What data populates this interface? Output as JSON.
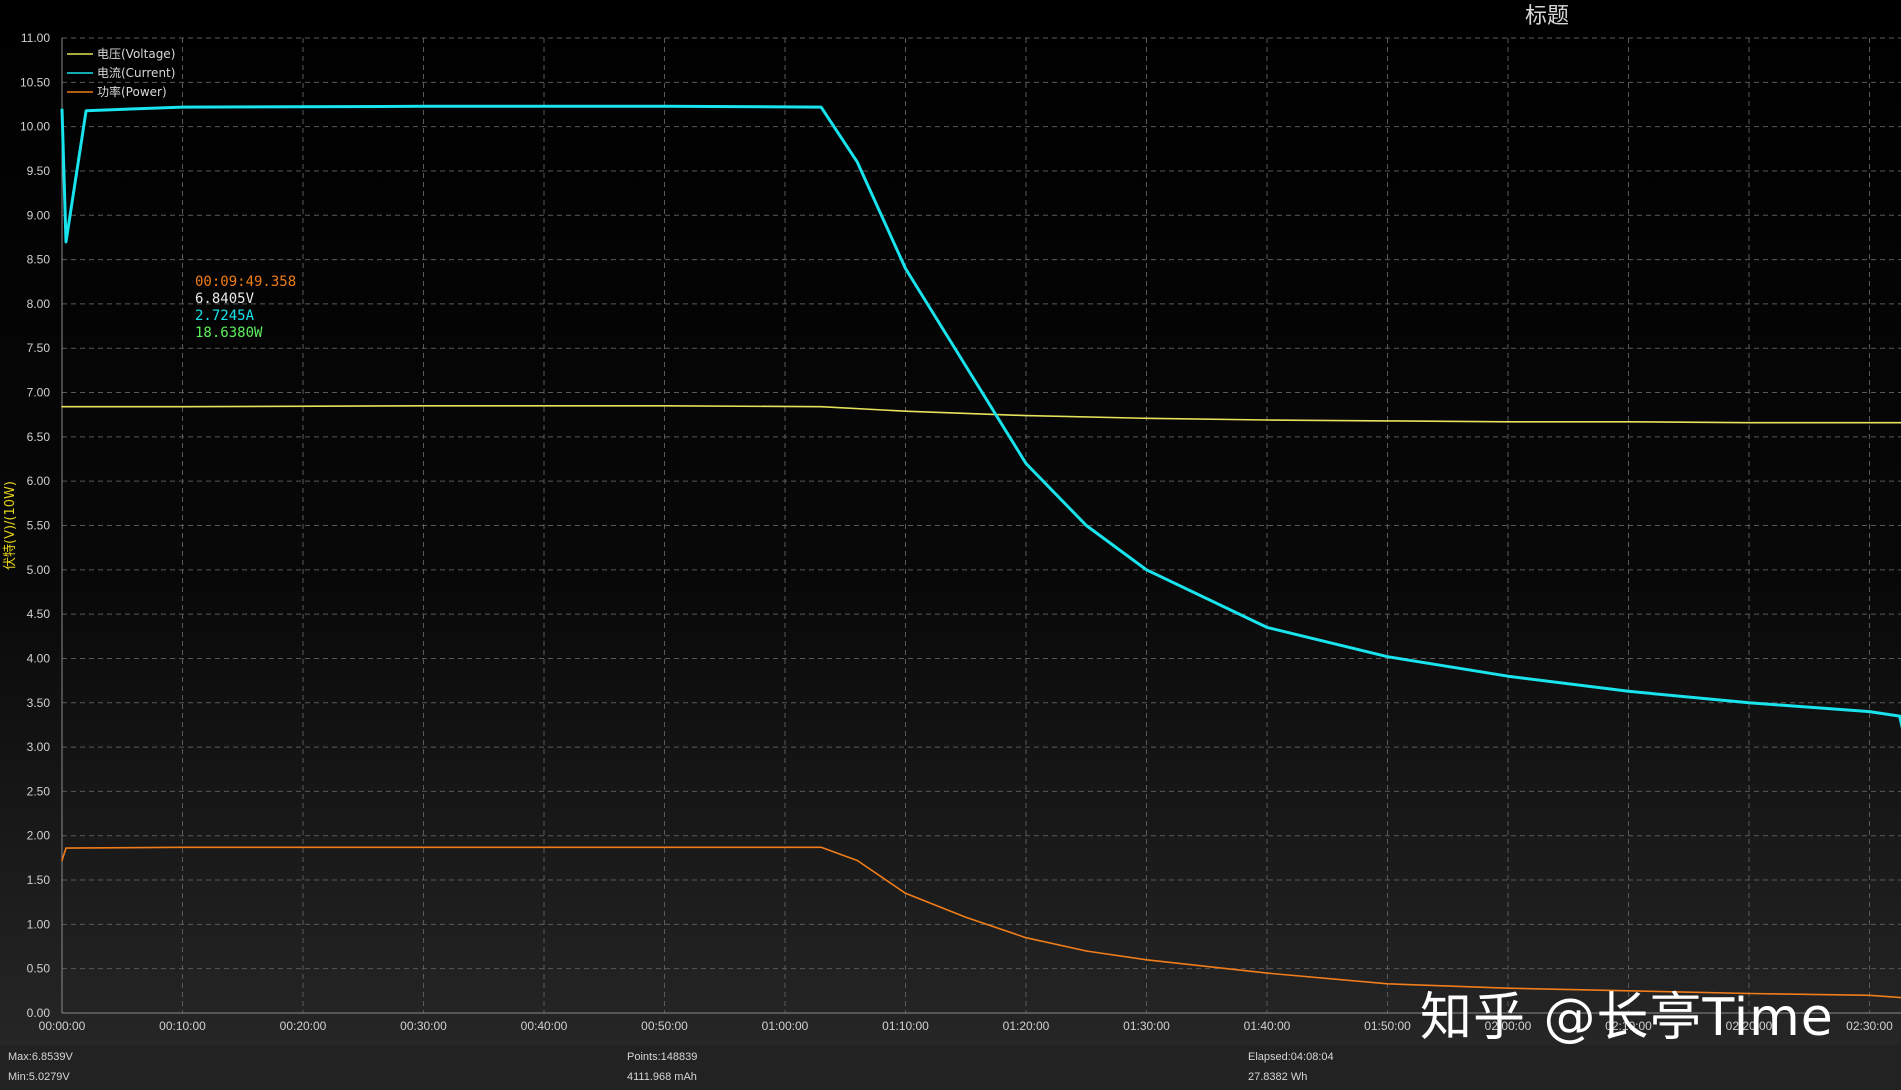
{
  "chart_data": {
    "type": "line",
    "title": "标题",
    "ylabel": "伏特(V)/(10W)",
    "xlabel": "",
    "ylim": [
      0,
      11
    ],
    "xlim_minutes": [
      0,
      153
    ],
    "grid": true,
    "legend_position": "top-left",
    "y_ticks": [
      "0.00",
      "0.50",
      "1.00",
      "1.50",
      "2.00",
      "2.50",
      "3.00",
      "3.50",
      "4.00",
      "4.50",
      "5.00",
      "5.50",
      "6.00",
      "6.50",
      "7.00",
      "7.50",
      "8.00",
      "8.50",
      "9.00",
      "9.50",
      "10.00",
      "10.50",
      "11.00"
    ],
    "x_ticks": [
      "00:00:00",
      "00:10:00",
      "00:20:00",
      "00:30:00",
      "00:40:00",
      "00:50:00",
      "01:00:00",
      "01:10:00",
      "01:20:00",
      "01:30:00",
      "01:40:00",
      "01:50:00",
      "02:00:00",
      "02:10:00",
      "02:20:00",
      "02:30:00"
    ],
    "series": [
      {
        "name": "电压(Voltage)",
        "color": "#e6e25a",
        "x": [
          "00:00:00",
          "00:10:00",
          "00:30:00",
          "00:50:00",
          "01:03:00",
          "01:10:00",
          "01:20:00",
          "01:30:00",
          "01:40:00",
          "01:50:00",
          "02:00:00",
          "02:10:00",
          "02:20:00",
          "02:30:00",
          "02:33:00"
        ],
        "values": [
          6.84,
          6.84,
          6.85,
          6.85,
          6.84,
          6.79,
          6.74,
          6.71,
          6.69,
          6.68,
          6.67,
          6.67,
          6.66,
          6.66,
          6.66
        ]
      },
      {
        "name": "电流(Current)",
        "color": "#19e3ec",
        "x": [
          "00:00:00",
          "00:00:20",
          "00:02:00",
          "00:10:00",
          "00:30:00",
          "00:50:00",
          "01:03:00",
          "01:06:00",
          "01:10:00",
          "01:15:00",
          "01:20:00",
          "01:25:00",
          "01:30:00",
          "01:40:00",
          "01:50:00",
          "02:00:00",
          "02:10:00",
          "02:20:00",
          "02:30:00",
          "02:32:30",
          "02:33:00"
        ],
        "values": [
          10.2,
          8.7,
          10.18,
          10.22,
          10.23,
          10.23,
          10.22,
          9.6,
          8.4,
          7.3,
          6.2,
          5.5,
          5.0,
          4.35,
          4.02,
          3.8,
          3.63,
          3.5,
          3.4,
          3.35,
          3.05
        ]
      },
      {
        "name": "功率(Power)",
        "color": "#f07d1a",
        "x": [
          "00:00:00",
          "00:00:20",
          "00:10:00",
          "00:30:00",
          "00:50:00",
          "01:03:00",
          "01:06:00",
          "01:10:00",
          "01:15:00",
          "01:20:00",
          "01:25:00",
          "01:30:00",
          "01:40:00",
          "01:50:00",
          "02:00:00",
          "02:10:00",
          "02:20:00",
          "02:30:00",
          "02:33:00"
        ],
        "values": [
          1.72,
          1.86,
          1.87,
          1.87,
          1.87,
          1.87,
          1.72,
          1.35,
          1.08,
          0.85,
          0.7,
          0.6,
          0.45,
          0.33,
          0.28,
          0.25,
          0.22,
          0.2,
          0.17
        ]
      }
    ],
    "cursor_readout": {
      "time": "00:09:49.358",
      "voltage": "6.8405V",
      "current": "2.7245A",
      "power": "18.6380W"
    }
  },
  "stats": {
    "max": "Max:6.8539V",
    "min": "Min:5.0279V",
    "points": "Points:148839",
    "capacity": "4111.968 mAh",
    "elapsed": "Elapsed:04:08:04",
    "energy": "27.8382 Wh"
  },
  "watermark": "知乎 @长亭Time"
}
